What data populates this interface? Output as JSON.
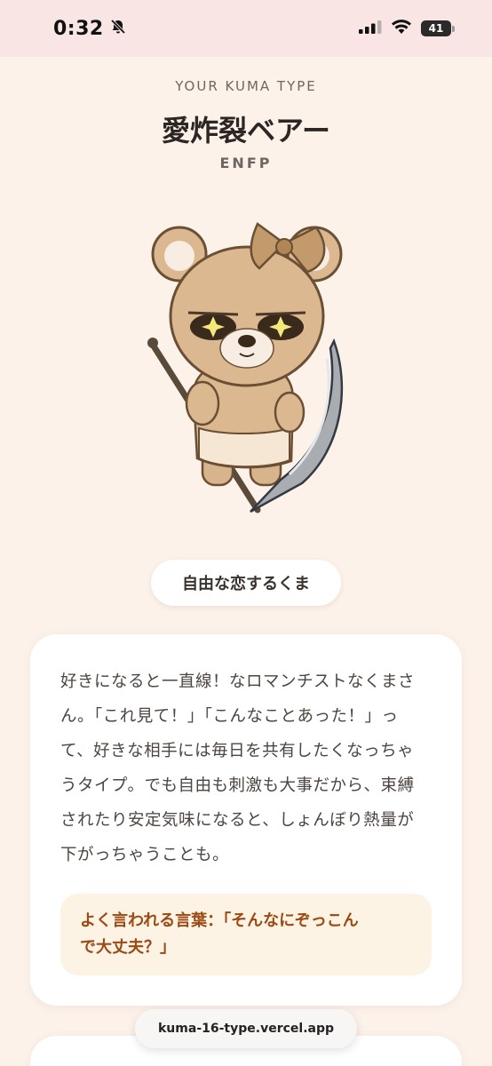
{
  "status_bar": {
    "time": "0:32",
    "battery_level": "41",
    "icons": [
      "bell-slash-icon",
      "cellular-signal-icon",
      "wifi-icon",
      "battery-icon"
    ]
  },
  "header": {
    "kicker": "YOUR KUMA TYPE",
    "title": "愛炸裂ベアー",
    "type_code": "ENFP"
  },
  "illustration": {
    "subject": "bear-with-scythe"
  },
  "tag": {
    "label": "自由な恋するくま"
  },
  "description": {
    "lines": [
      "好きになると一直線！なロマンチストなくまさ",
      "ん。「これ見て！」「こんなことあった！」っ",
      "て、好きな相手には毎日を共有したくなっちゃ",
      "うタイプ。でも自由も刺激も大事だから、束縛",
      "されたり安定気味になると、しょんぼり熱量が",
      "下がっちゃうことも。"
    ],
    "quote_lines": [
      "よく言われる言葉：「そんなにぞっこん",
      "で大丈夫？」"
    ]
  },
  "browser": {
    "url": "kuma-16-type.vercel.app"
  },
  "colors": {
    "background": "#fcf2ea",
    "status_bar": "#f9e6e4",
    "quote_text": "#9b4a14",
    "quote_bg": "#fdf3e4"
  }
}
